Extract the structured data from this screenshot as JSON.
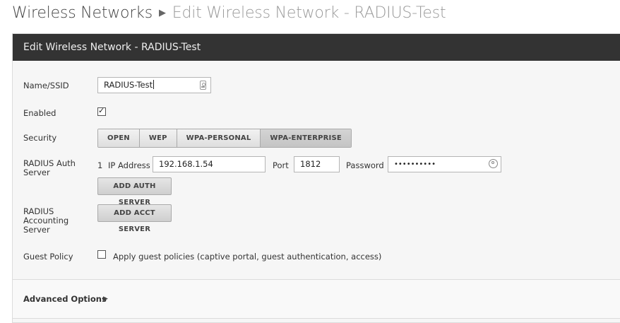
{
  "breadcrumb": {
    "parent": "Wireless Networks",
    "separator": "▶",
    "current": "Edit Wireless Network - RADIUS-Test"
  },
  "panel": {
    "title": "Edit Wireless Network - RADIUS-Test"
  },
  "form": {
    "name_label": "Name/SSID",
    "name_value": "RADIUS-Test",
    "enabled_label": "Enabled",
    "enabled_checked": "✓",
    "security_label": "Security",
    "security_options": [
      "OPEN",
      "WEP",
      "WPA-PERSONAL",
      "WPA-ENTERPRISE"
    ],
    "radius_auth_label": "RADIUS Auth Server",
    "auth_index": "1",
    "ip_label": "IP Address",
    "ip_value": "192.168.1.54",
    "port_label": "Port",
    "port_value": "1812",
    "password_label": "Password",
    "password_value": "••••••••••",
    "add_auth_button": "ADD AUTH SERVER",
    "radius_acct_label": "RADIUS Accounting Server",
    "add_acct_button": "ADD ACCT SERVER",
    "guest_policy_label": "Guest Policy",
    "guest_policy_text": "Apply guest policies (captive portal, guest authentication, access)"
  },
  "advanced": {
    "label": "Advanced Options",
    "arrow": "▶"
  }
}
